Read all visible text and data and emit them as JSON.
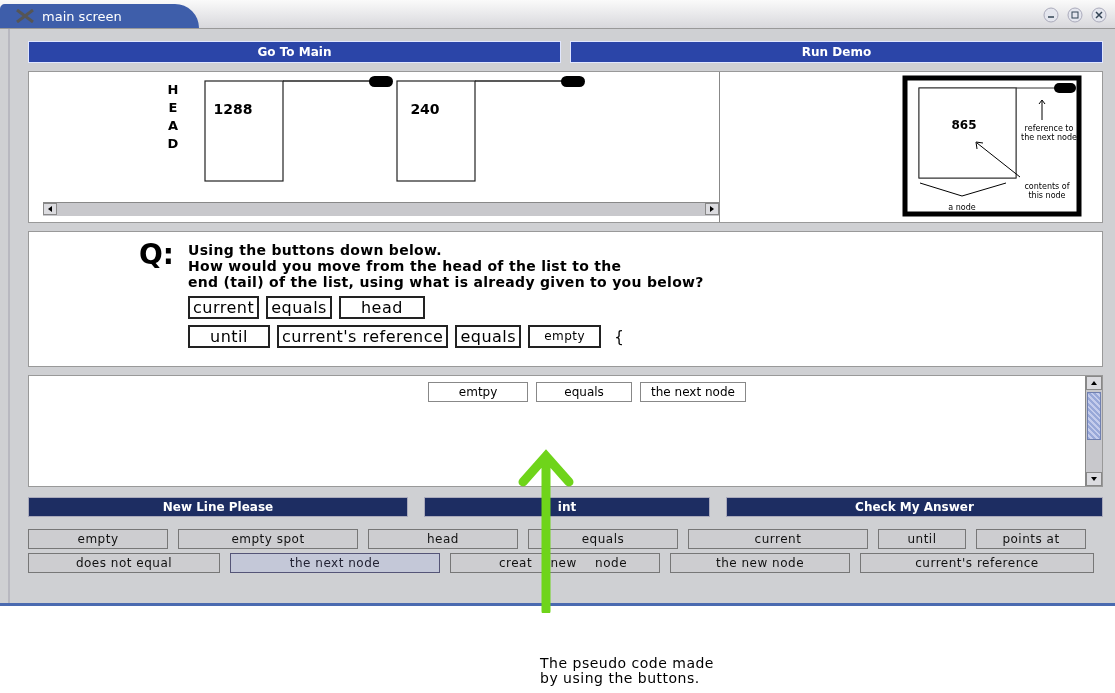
{
  "window": {
    "title": "main screen"
  },
  "nav_buttons": [
    "Go To Main",
    "Run Demo"
  ],
  "list_diagram": {
    "head_label": [
      "H",
      "E",
      "A",
      "D"
    ],
    "nodes": [
      "1288",
      "240"
    ]
  },
  "legend": {
    "value": "865",
    "reference_label": [
      "reference to",
      "the next node"
    ],
    "contents_label": [
      "contents of",
      "this node"
    ],
    "node_label": "a node"
  },
  "question": {
    "mark": "Q:",
    "lines": [
      "Using the buttons down below.",
      "How would you move from the head of the list to the",
      "end (tail) of the list, using what is already given to you below?"
    ],
    "code_lines": [
      [
        {
          "kind": "word",
          "text": "current"
        },
        {
          "kind": "word",
          "text": "equals"
        },
        {
          "kind": "wide",
          "text": "head"
        }
      ],
      [
        {
          "kind": "wide",
          "text": "until"
        },
        {
          "kind": "word",
          "text": "current's reference"
        },
        {
          "kind": "word",
          "text": "equals"
        },
        {
          "kind": "small",
          "text": "empty"
        },
        {
          "kind": "symbol",
          "text": "{"
        }
      ]
    ]
  },
  "answer": {
    "chips": [
      "emtpy",
      "equals",
      "the next node"
    ]
  },
  "action_buttons": [
    "New Line Please",
    "int",
    "Check My Answer"
  ],
  "palette": [
    [
      {
        "label": "empty",
        "selected": false
      },
      {
        "label": "empty spot",
        "selected": false
      },
      {
        "label": "head",
        "selected": false
      },
      {
        "label": "equals",
        "selected": false
      },
      {
        "label": "current",
        "selected": false
      },
      {
        "label": "until",
        "selected": false
      },
      {
        "label": "points at",
        "selected": false
      }
    ],
    [
      {
        "label": "does not equal",
        "selected": false
      },
      {
        "label": "the next node",
        "selected": true
      },
      {
        "label": "creat new node",
        "selected": false
      },
      {
        "label": "the new node",
        "selected": false
      },
      {
        "label": "current's reference",
        "selected": false
      }
    ]
  ],
  "annotation": {
    "caption": [
      "The pseudo code made",
      "by using the buttons."
    ]
  }
}
